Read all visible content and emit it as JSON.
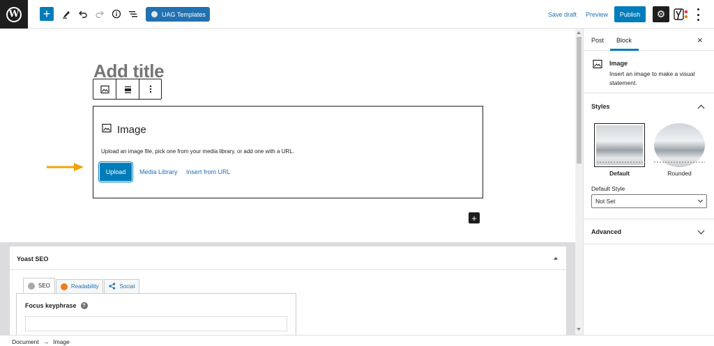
{
  "topbar": {
    "logo": "W",
    "add_block_label": "+",
    "uag_label": "UAG Templates",
    "save_draft": "Save draft",
    "preview": "Preview",
    "publish": "Publish",
    "settings_icon": "⚙"
  },
  "editor": {
    "title_placeholder": "Add title",
    "image_block": {
      "label": "Image",
      "instructions": "Upload an image file, pick one from your media library, or add one with a URL.",
      "upload": "Upload",
      "media_library": "Media Library",
      "insert_from_url": "Insert from URL"
    },
    "inserter_label": "+",
    "highlight_arrow_color": "#f0a30a"
  },
  "yoast": {
    "title": "Yoast SEO",
    "tabs": [
      {
        "label": "SEO"
      },
      {
        "label": "Readability"
      },
      {
        "label": "Social"
      }
    ],
    "focus_keyphrase": "Focus keyphrase",
    "help": "?"
  },
  "sidebar": {
    "tabs": [
      "Post",
      "Block"
    ],
    "active_tab": "Block",
    "close": "×",
    "block_card": {
      "title": "Image",
      "description": "Insert an image to make a visual statement."
    },
    "styles": {
      "heading": "Styles",
      "options": [
        "Default",
        "Rounded"
      ],
      "selected": "Default",
      "default_style_label": "Default Style",
      "default_style_value": "Not Set"
    },
    "advanced": "Advanced"
  },
  "footer": {
    "breadcrumb": [
      "Document",
      "→",
      "Image"
    ]
  },
  "colors": {
    "accent": "#007cba",
    "link": "#2271b1",
    "dark": "#1e1e1e"
  }
}
